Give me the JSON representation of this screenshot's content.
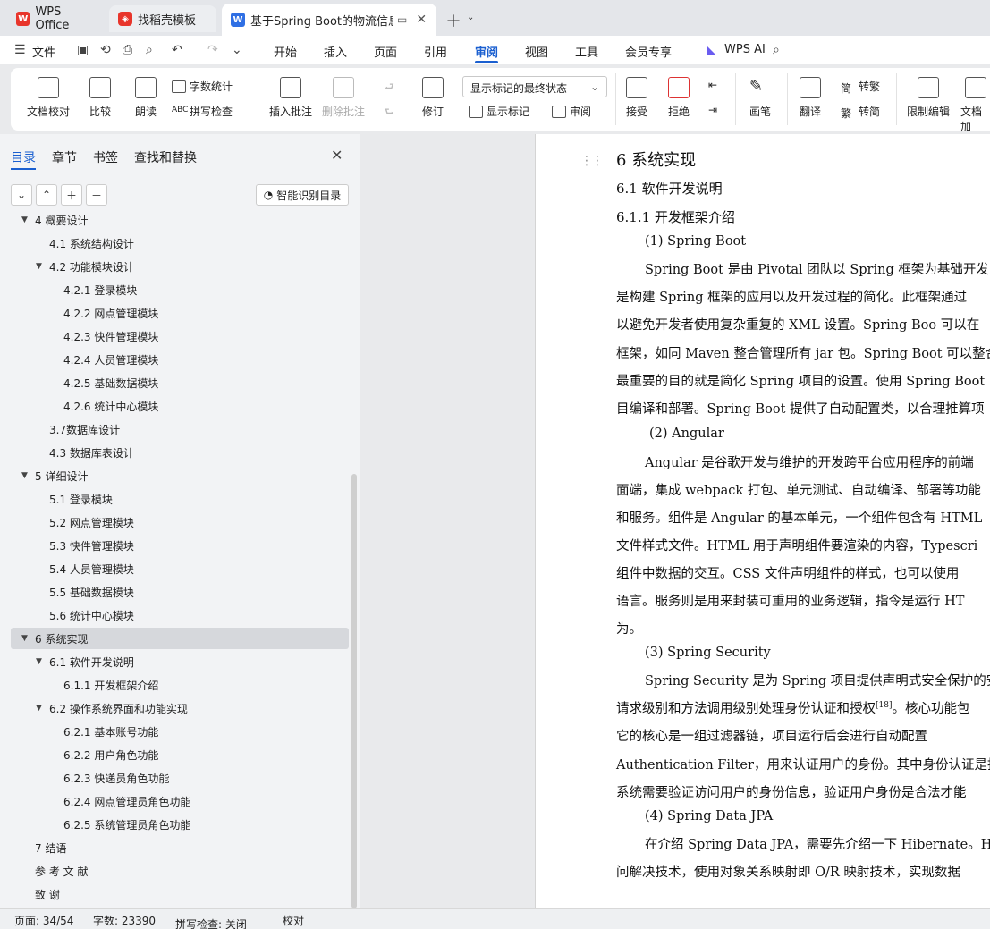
{
  "tabs": [
    {
      "label": "WPS Office"
    },
    {
      "label": "找稻壳模板"
    },
    {
      "label": "基于Spring Boot的物流信息管"
    }
  ],
  "menubar": {
    "file": "文件",
    "items": [
      "开始",
      "插入",
      "页面",
      "引用",
      "审阅",
      "视图",
      "工具",
      "会员专享"
    ],
    "active": "审阅",
    "ai": "WPS AI"
  },
  "ribbon": {
    "doc_check": "文档校对",
    "compare": "比较",
    "read_aloud": "朗读",
    "word_count": "字数统计",
    "spell_check": "拼写检查",
    "insert_comment": "插入批注",
    "delete_comment": "删除批注",
    "revise": "修订",
    "markup_state": "显示标记的最终状态",
    "show_markup": "显示标记",
    "review": "审阅",
    "accept": "接受",
    "reject": "拒绝",
    "pen": "画笔",
    "translate": "翻译",
    "to_traditional": "转繁",
    "to_simplified": "转简",
    "restrict_edit": "限制编辑",
    "doc_encrypt": "文档加"
  },
  "nav": {
    "tabs": [
      "目录",
      "章节",
      "书签",
      "查找和替换"
    ],
    "active_tab": "目录",
    "smart_toc": "智能识别目录",
    "items": [
      {
        "label": "4   概要设计",
        "level": 0,
        "expanded": true
      },
      {
        "label": "4.1   系统结构设计",
        "level": 1
      },
      {
        "label": "4.2   功能模块设计",
        "level": 1,
        "expanded": true
      },
      {
        "label": "4.2.1   登录模块",
        "level": 2
      },
      {
        "label": "4.2.2   网点管理模块",
        "level": 2
      },
      {
        "label": "4.2.3   快件管理模块",
        "level": 2
      },
      {
        "label": "4.2.4   人员管理模块",
        "level": 2
      },
      {
        "label": "4.2.5   基础数据模块",
        "level": 2
      },
      {
        "label": "4.2.6   统计中心模块",
        "level": 2
      },
      {
        "label": "3.7数据库设计",
        "level": 1
      },
      {
        "label": "4.3   数据库表设计",
        "level": 1
      },
      {
        "label": "5   详细设计",
        "level": 0,
        "expanded": true
      },
      {
        "label": "5.1   登录模块",
        "level": 1
      },
      {
        "label": "5.2   网点管理模块",
        "level": 1
      },
      {
        "label": "5.3   快件管理模块",
        "level": 1
      },
      {
        "label": "5.4   人员管理模块",
        "level": 1
      },
      {
        "label": "5.5   基础数据模块",
        "level": 1
      },
      {
        "label": "5.6   统计中心模块",
        "level": 1
      },
      {
        "label": "6   系统实现",
        "level": 0,
        "expanded": true,
        "selected": true
      },
      {
        "label": "6.1   软件开发说明",
        "level": 1,
        "expanded": true
      },
      {
        "label": "6.1.1   开发框架介绍",
        "level": 2
      },
      {
        "label": "6.2   操作系统界面和功能实现",
        "level": 1,
        "expanded": true
      },
      {
        "label": "6.2.1   基本账号功能",
        "level": 2
      },
      {
        "label": "6.2.2   用户角色功能",
        "level": 2
      },
      {
        "label": "6.2.3   快递员角色功能",
        "level": 2
      },
      {
        "label": "6.2.4   网点管理员角色功能",
        "level": 2
      },
      {
        "label": "6.2.5   系统管理员角色功能",
        "level": 2
      },
      {
        "label": "7   结语",
        "level": 0
      },
      {
        "label": "参  考  文  献",
        "level": 0
      },
      {
        "label": "致          谢",
        "level": 0
      }
    ]
  },
  "doc": {
    "lines": [
      {
        "text": "6   系统实现",
        "cls": "h1",
        "indent": 0
      },
      {
        "text": "6.1   软件开发说明",
        "cls": "h2",
        "indent": 0
      },
      {
        "text": "6.1.1   开发框架介绍",
        "cls": "h2",
        "indent": 0
      },
      {
        "text": "(1)   Spring Boot",
        "cls": "",
        "indent": 1
      },
      {
        "text": "Spring Boot 是由 Pivotal 团队以 Spring 框架为基础开发的",
        "cls": "",
        "indent": 1
      },
      {
        "text": "是构建 Spring 框架的应用以及开发过程的简化。此框架通过",
        "cls": "",
        "indent": 0
      },
      {
        "text": "以避免开发者使用复杂重复的 XML 设置。Spring Boo 可以在",
        "cls": "",
        "indent": 0
      },
      {
        "text": "框架，如同 Maven 整合管理所有 jar 包。Spring Boot 可以整合",
        "cls": "",
        "indent": 0
      },
      {
        "text": "最重要的目的就是简化 Spring 项目的设置。使用 Spring Boot",
        "cls": "",
        "indent": 0
      },
      {
        "text": "目编译和部署。Spring Boot 提供了自动配置类，以合理推算项",
        "cls": "",
        "indent": 0
      },
      {
        "text": "(2)   Angular",
        "cls": "",
        "indent": 1
      },
      {
        "text": "Angular 是谷歌开发与维护的开发跨平台应用程序的前端",
        "cls": "",
        "indent": 1
      },
      {
        "text": "面端，集成 webpack 打包、单元测试、自动编译、部署等功能",
        "cls": "",
        "indent": 0
      },
      {
        "text": "和服务。组件是 Angular 的基本单元，一个组件包含有 HTML",
        "cls": "",
        "indent": 0
      },
      {
        "text": "文件样式文件。HTML 用于声明组件要渲染的内容，Typescri",
        "cls": "",
        "indent": 0
      },
      {
        "text": "组件中数据的交互。CSS 文件声明组件的样式，也可以使用",
        "cls": "",
        "indent": 0
      },
      {
        "text": "语言。服务则是用来封装可重用的业务逻辑，指令是运行 HT",
        "cls": "",
        "indent": 0
      },
      {
        "text": "为。",
        "cls": "",
        "indent": 0
      },
      {
        "text": "(3)   Spring Security",
        "cls": "",
        "indent": 1
      },
      {
        "text": "Spring Security 是为 Spring 项目提供声明式安全保护的安",
        "cls": "",
        "indent": 1
      },
      {
        "text": "请求级别和方法调用级别处理身份认证和授权[18]。核心功能包",
        "cls": "",
        "indent": 0
      },
      {
        "text": "它的核心是一组过滤器链，项目运行后会进行自动配置",
        "cls": "",
        "indent": 0
      },
      {
        "text": "Authentication Filter，用来认证用户的身份。其中身份认证是指",
        "cls": "",
        "indent": 0
      },
      {
        "text": "系统需要验证访问用户的身份信息，验证用户身份是合法才能",
        "cls": "",
        "indent": 0
      },
      {
        "text": "(4)   Spring Data JPA",
        "cls": "",
        "indent": 1
      },
      {
        "text": "在介绍 Spring Data JPA，需要先介绍一下 Hibernate。Hib",
        "cls": "",
        "indent": 1
      },
      {
        "text": "问解决技术，使用对象关系映射即 O/R 映射技术，实现数据",
        "cls": "",
        "indent": 0
      }
    ]
  },
  "status": {
    "page": "页面: 34/54",
    "words": "字数: 23390",
    "spell": "拼写检查: 关闭",
    "proof": "校对"
  }
}
